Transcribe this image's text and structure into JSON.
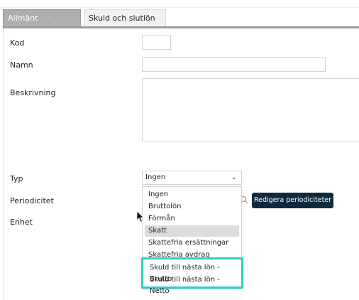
{
  "tabs": [
    {
      "label": "Allmänt",
      "active": true
    },
    {
      "label": "Skuld och slutlön",
      "active": false
    }
  ],
  "form": {
    "kod": {
      "label": "Kod",
      "value": ""
    },
    "namn": {
      "label": "Namn",
      "value": ""
    },
    "beskrivning": {
      "label": "Beskrivning",
      "value": ""
    },
    "typ": {
      "label": "Typ",
      "value": "Ingen"
    },
    "periodicitet": {
      "label": "Periodicitet"
    },
    "enhet": {
      "label": "Enhet"
    }
  },
  "dropdown": {
    "options": [
      "Ingen",
      "Bruttolön",
      "Förmån",
      "Skatt",
      "Skattefria ersättningar",
      "Skattefria avdrag",
      "Skuld till nästa lön - Brutto",
      "Skuld till nästa lön - Netto"
    ],
    "hover_index": 3,
    "highlighted_options": [
      6,
      7
    ]
  },
  "buttons": {
    "edit_periodicities": "Redigera periodiciteter"
  },
  "colors": {
    "button_bg": "#0e2a3d",
    "highlight_border": "#2ed0c3",
    "tab_active_bg": "#a9a9a9"
  }
}
